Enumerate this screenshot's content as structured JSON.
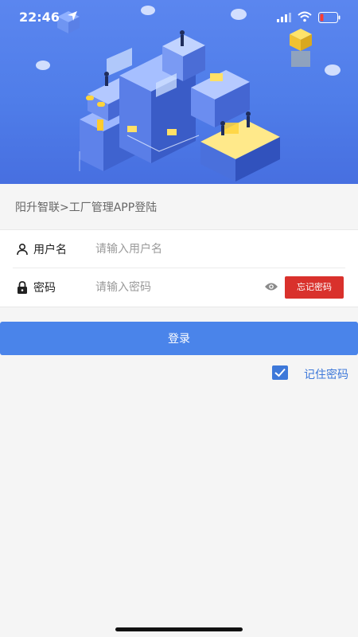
{
  "status_bar": {
    "time": "22:46",
    "icons": [
      "location-arrow-icon",
      "signal-icon",
      "wifi-icon",
      "battery-icon"
    ]
  },
  "hero": {
    "illustration": "isometric-data-center-illustration",
    "background_color": "#5b86ef"
  },
  "page": {
    "title": "阳升智联>工厂管理APP登陆"
  },
  "form": {
    "username": {
      "icon": "user-icon",
      "label": "用户名",
      "placeholder": "请输入用户名",
      "value": ""
    },
    "password": {
      "icon": "lock-icon",
      "label": "密码",
      "placeholder": "请输入密码",
      "value": "",
      "toggle_icon": "eye-icon",
      "forgot_label": "忘记密码"
    }
  },
  "actions": {
    "login_label": "登录",
    "remember_label": "记住密码",
    "remember_checked": true
  },
  "colors": {
    "primary": "#4a84ea",
    "danger": "#d9312c",
    "link": "#3d78d9"
  }
}
